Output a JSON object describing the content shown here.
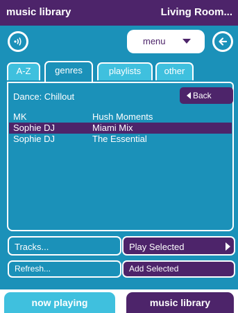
{
  "header": {
    "app_title": "music library",
    "zone_title": "Living Room..."
  },
  "toolbar": {
    "volume_icon": "speaker-waves-icon",
    "menu_label": "menu",
    "back_icon": "left-arrow-icon"
  },
  "tabs": [
    {
      "label": "A-Z",
      "active": false
    },
    {
      "label": "genres",
      "active": true
    },
    {
      "label": "playlists",
      "active": false
    },
    {
      "label": "other",
      "active": false
    }
  ],
  "list": {
    "heading": "Dance: Chillout",
    "back_label": "Back",
    "rows": [
      {
        "artist": "MK",
        "album": "Hush Moments",
        "selected": false
      },
      {
        "artist": "Sophie DJ",
        "album": "Miami Mix",
        "selected": true
      },
      {
        "artist": "Sophie DJ",
        "album": "The Essential",
        "selected": false
      }
    ]
  },
  "actions": {
    "tracks": "Tracks...",
    "play_selected": "Play Selected",
    "refresh": "Refresh...",
    "add_selected": "Add Selected"
  },
  "bottom_nav": {
    "now_playing": "now playing",
    "music_library": "music library"
  },
  "colors": {
    "purple": "#4d246a",
    "teal": "#1b91b9",
    "light_teal": "#3fc0de"
  }
}
